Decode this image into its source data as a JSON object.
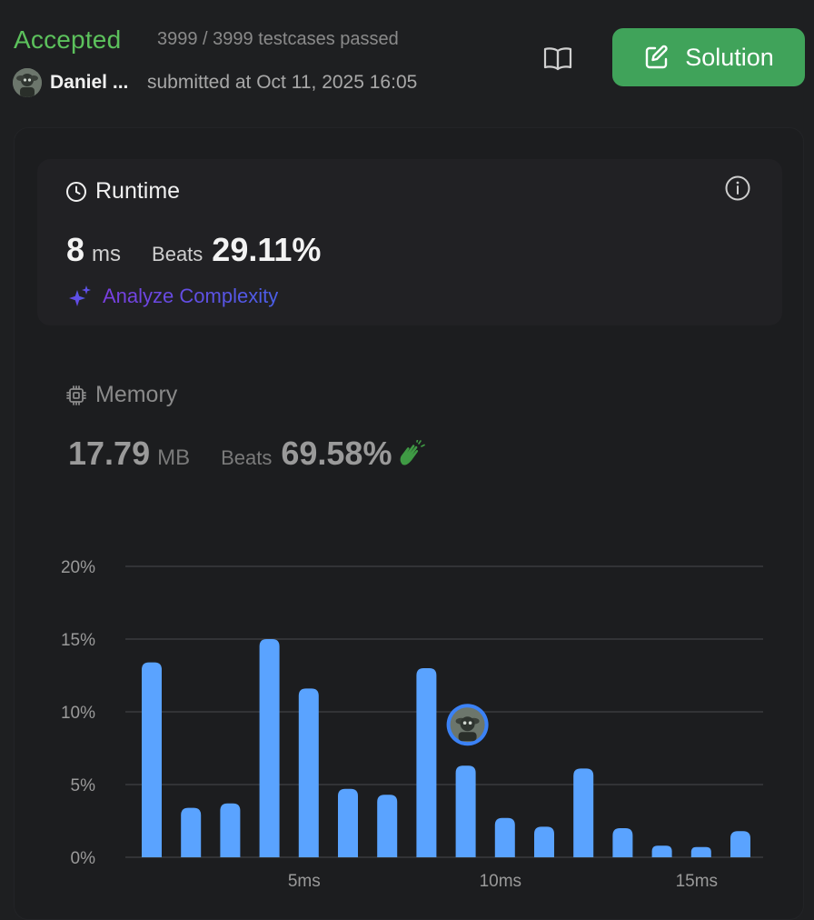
{
  "header": {
    "status": "Accepted",
    "testcases": "3999 / 3999 testcases passed",
    "username": "Daniel ...",
    "submitted": "submitted at Oct 11, 2025 16:05",
    "solution_label": "Solution"
  },
  "runtime": {
    "title": "Runtime",
    "value": "8",
    "unit": "ms",
    "beats_label": "Beats",
    "beats_value": "29.11%",
    "analyze_label": "Analyze Complexity"
  },
  "memory": {
    "title": "Memory",
    "value": "17.79",
    "unit": "MB",
    "beats_label": "Beats",
    "beats_value": "69.58%"
  },
  "colors": {
    "accent_green": "#5cc15c",
    "solution_button": "#40a35a",
    "bar_blue": "#5aa3ff",
    "avatar_ring": "#3b82f6"
  },
  "icons": {
    "runtime": "clock-icon",
    "memory": "chip-icon",
    "info": "info-icon",
    "editorial": "book-icon",
    "solution": "edit-icon",
    "analyze": "sparkle-icon",
    "beats": "clapping-hands-icon"
  },
  "chart_data": {
    "type": "bar",
    "x": [
      1,
      2,
      3,
      4,
      5,
      6,
      7,
      8,
      9,
      10,
      11,
      12,
      13,
      14,
      15,
      16
    ],
    "values": [
      13.4,
      3.4,
      3.7,
      15.0,
      11.6,
      4.7,
      4.3,
      13.0,
      6.3,
      2.7,
      2.1,
      6.1,
      2.0,
      0.8,
      0.7,
      1.8
    ],
    "user_x": 9,
    "xticks": [
      5,
      10,
      15
    ],
    "xtick_labels": [
      "5ms",
      "10ms",
      "15ms"
    ],
    "yticks": [
      0,
      5,
      10,
      15,
      20
    ],
    "ytick_labels": [
      "0%",
      "5%",
      "10%",
      "15%",
      "20%"
    ],
    "ylim": [
      0,
      20
    ],
    "grid": true
  }
}
